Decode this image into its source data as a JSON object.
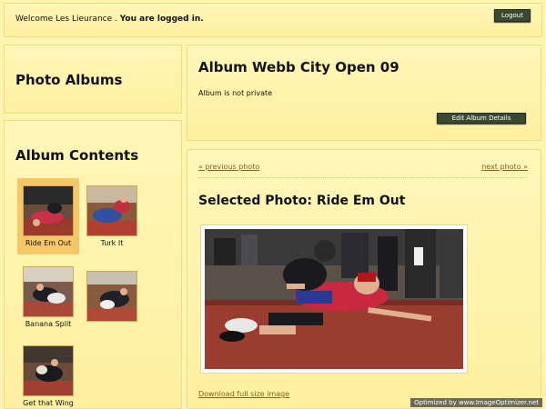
{
  "header": {
    "welcome_text": "Welcome Les Lieurance .",
    "logged_in_text": "You are logged in.",
    "logout_label": "Logout"
  },
  "albums_panel": {
    "title": "Photo Albums"
  },
  "album": {
    "title": "Album Webb City Open 09",
    "privacy": "Album is not private",
    "edit_label": "Edit Album Details"
  },
  "contents": {
    "title": "Album Contents",
    "items": [
      {
        "caption": "Ride Em Out",
        "selected": true
      },
      {
        "caption": "Turk It",
        "selected": false
      },
      {
        "caption": "Banana Split",
        "selected": false
      },
      {
        "caption": "",
        "selected": false
      },
      {
        "caption": "Get that Wing",
        "selected": false
      }
    ]
  },
  "photo": {
    "prev_label": "« previous photo",
    "next_label": "next photo »",
    "selected_title": "Selected Photo: Ride Em Out",
    "download_label": "Download full size image"
  },
  "watermark": "Optimized by www.ImageOptimizer.net",
  "colors": {
    "panel_bg": "#fff4b0",
    "button_bg": "#3a4a32",
    "link": "#8a6020",
    "selected_thumb_bg": "#f6c766"
  }
}
